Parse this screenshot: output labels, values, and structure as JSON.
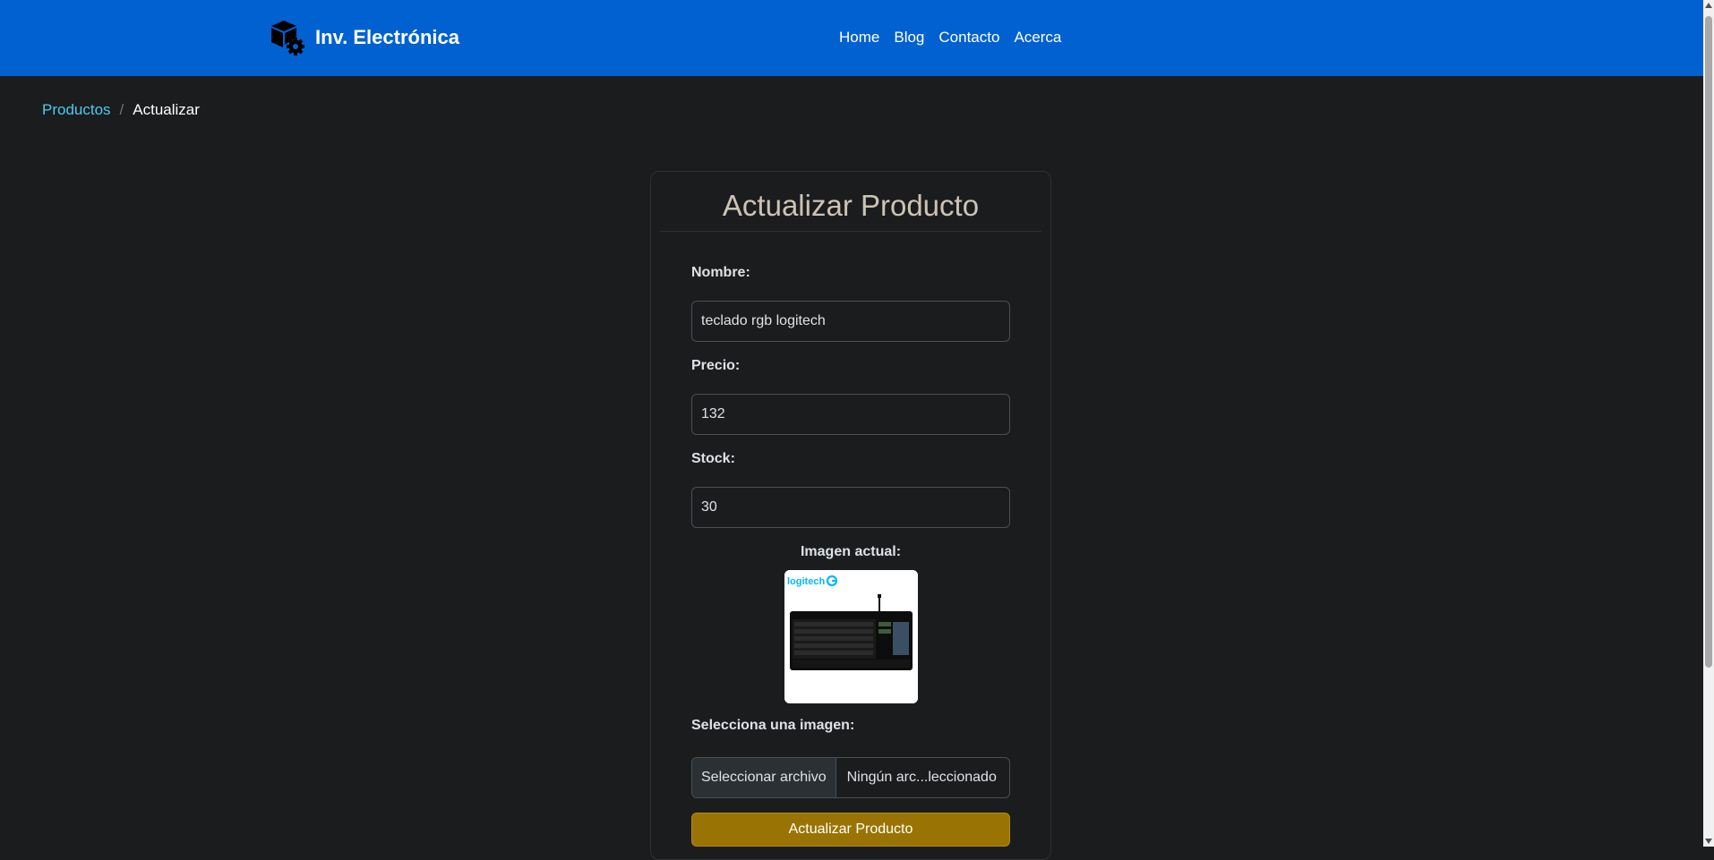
{
  "brand": {
    "name": "Inv. Electrónica",
    "icon": "box-gear-icon"
  },
  "nav": [
    "Home",
    "Blog",
    "Contacto",
    "Acerca"
  ],
  "breadcrumb": {
    "parent": "Productos",
    "separator": "/",
    "current": "Actualizar"
  },
  "form": {
    "title": "Actualizar Producto",
    "nombre": {
      "label": "Nombre:",
      "value": "teclado rgb logitech"
    },
    "precio": {
      "label": "Precio:",
      "value": "132"
    },
    "stock": {
      "label": "Stock:",
      "value": "30"
    },
    "image": {
      "label": "Imagen actual:",
      "logo_text": "logitech"
    },
    "file": {
      "label": "Selecciona una imagen:",
      "button": "Seleccionar archivo",
      "status": "Ningún arc...leccionado"
    },
    "submit": "Actualizar Producto"
  },
  "colors": {
    "navbar": "#0161d1",
    "background": "#1b1c1e",
    "link": "#4ccbf2",
    "submit": "#997404"
  }
}
